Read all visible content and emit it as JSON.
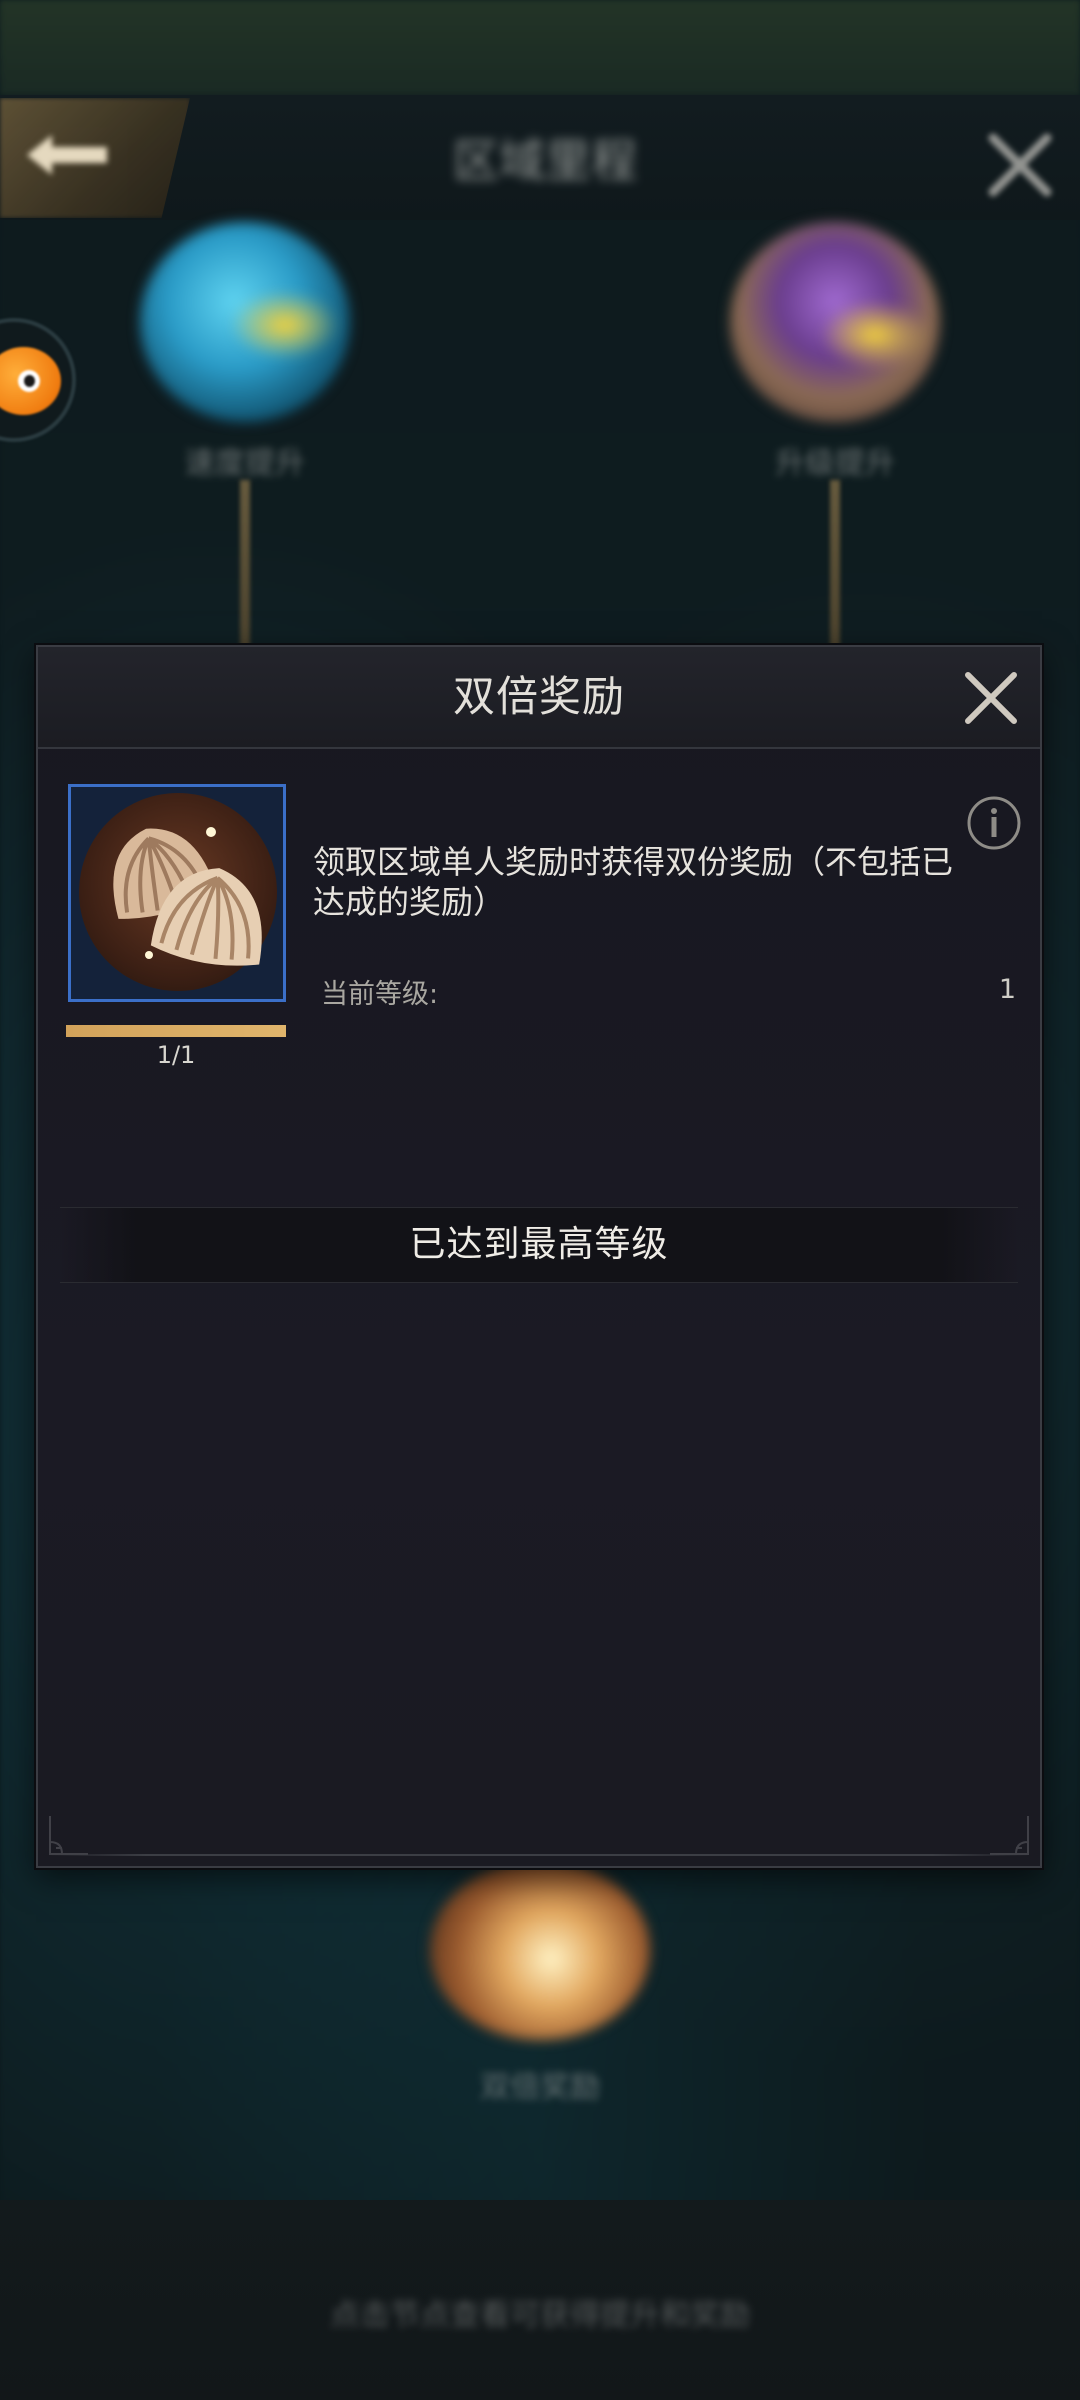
{
  "background": {
    "header_title": "区域里程",
    "nodes": [
      {
        "label": "速度提升"
      },
      {
        "label": "升级提升"
      },
      {
        "label": "双倍奖励"
      }
    ],
    "bottom_text": "点击节点查看可获得提升和奖励"
  },
  "modal": {
    "title": "双倍奖励",
    "description": "领取区域单人奖励时获得双份奖励（不包括已达成的奖励）",
    "level_label": "当前等级:",
    "level_value": "1",
    "progress_text": "1/1",
    "progress_fraction": 1.0,
    "max_level_text": "已达到最高等级"
  },
  "colors": {
    "accent_gold": "#d2a25a",
    "frame_blue": "#3b6fc8",
    "text_primary": "#e6e3dd",
    "text_secondary": "#a9a7a1"
  },
  "icons": {
    "close": "close-icon",
    "info": "info-icon",
    "back": "back-arrow-icon",
    "item": "shell-icon"
  }
}
